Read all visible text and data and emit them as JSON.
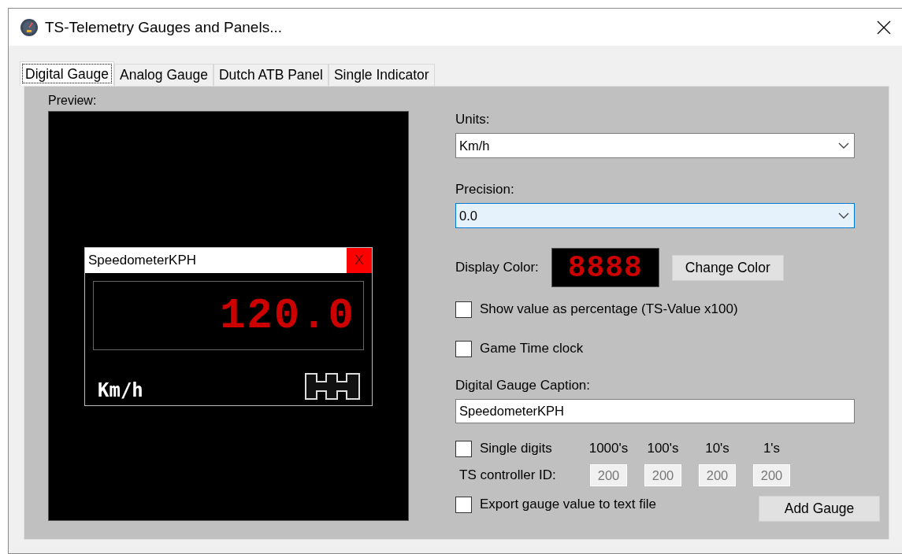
{
  "window": {
    "title": "TS-Telemetry Gauges and Panels..."
  },
  "tabs": [
    {
      "label": "Digital Gauge",
      "selected": true
    },
    {
      "label": "Analog Gauge",
      "selected": false
    },
    {
      "label": "Dutch ATB Panel",
      "selected": false
    },
    {
      "label": "Single Indicator",
      "selected": false
    }
  ],
  "preview": {
    "label": "Preview:",
    "gauge": {
      "caption": "SpeedometerKPH",
      "close": "X",
      "value": "120.0",
      "unit": "Km/h"
    }
  },
  "units": {
    "label": "Units:",
    "value": "Km/h"
  },
  "precision": {
    "label": "Precision:",
    "value": "0.0",
    "focused": true
  },
  "display_color": {
    "label": "Display Color:",
    "sample": "8888",
    "color": "#cc0000",
    "button": "Change Color"
  },
  "show_percentage": {
    "label": "Show value as percentage (TS-Value x100)",
    "checked": false
  },
  "game_time_clock": {
    "label": "Game Time clock",
    "checked": false
  },
  "caption": {
    "label": "Digital Gauge Caption:",
    "value": "SpeedometerKPH"
  },
  "single_digits": {
    "label": "Single digits",
    "checked": false,
    "columns": [
      "1000's",
      "100's",
      "10's",
      "1's"
    ]
  },
  "controller_id": {
    "label": "TS controller ID:",
    "values": [
      "200",
      "200",
      "200",
      "200"
    ]
  },
  "export": {
    "label": "Export gauge value to text file",
    "checked": false
  },
  "add_button": "Add Gauge"
}
